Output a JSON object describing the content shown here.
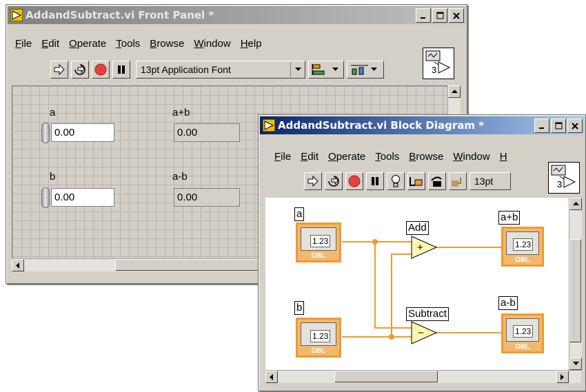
{
  "front_panel": {
    "title": "AddandSubtract.vi Front Panel *",
    "menu": [
      {
        "label": "File",
        "ul": "F",
        "rest": "ile"
      },
      {
        "label": "Edit",
        "ul": "E",
        "rest": "dit"
      },
      {
        "label": "Operate",
        "ul": "O",
        "rest": "perate"
      },
      {
        "label": "Tools",
        "ul": "T",
        "rest": "ools"
      },
      {
        "label": "Browse",
        "ul": "B",
        "rest": "rowse"
      },
      {
        "label": "Window",
        "ul": "W",
        "rest": "indow"
      },
      {
        "label": "Help",
        "ul": "H",
        "rest": "elp"
      }
    ],
    "font_selector": "13pt Application Font",
    "vi_icon_number": "3",
    "controls": {
      "a_label": "a",
      "a_value": "0.00",
      "b_label": "b",
      "b_value": "0.00"
    },
    "indicators": {
      "sum_label": "a+b",
      "sum_value": "0.00",
      "diff_label": "a-b",
      "diff_value": "0.00"
    }
  },
  "block_diagram": {
    "title": "AddandSubtract.vi Block Diagram *",
    "menu": [
      {
        "label": "File",
        "ul": "F",
        "rest": "ile"
      },
      {
        "label": "Edit",
        "ul": "E",
        "rest": "dit"
      },
      {
        "label": "Operate",
        "ul": "O",
        "rest": "perate"
      },
      {
        "label": "Tools",
        "ul": "T",
        "rest": "ools"
      },
      {
        "label": "Browse",
        "ul": "B",
        "rest": "rowse"
      },
      {
        "label": "Window",
        "ul": "W",
        "rest": "indow"
      },
      {
        "label": "Help (truncated)",
        "ul": "H",
        "rest": ""
      }
    ],
    "font_selector": "13pt",
    "vi_icon_number": "3",
    "nodes": {
      "a_label": "a",
      "b_label": "b",
      "sum_label": "a+b",
      "diff_label": "a-b",
      "add_label": "Add",
      "subtract_label": "Subtract",
      "terminal_value": "1.23",
      "terminal_type": "DBL"
    },
    "wire_color": "#f09a30"
  }
}
